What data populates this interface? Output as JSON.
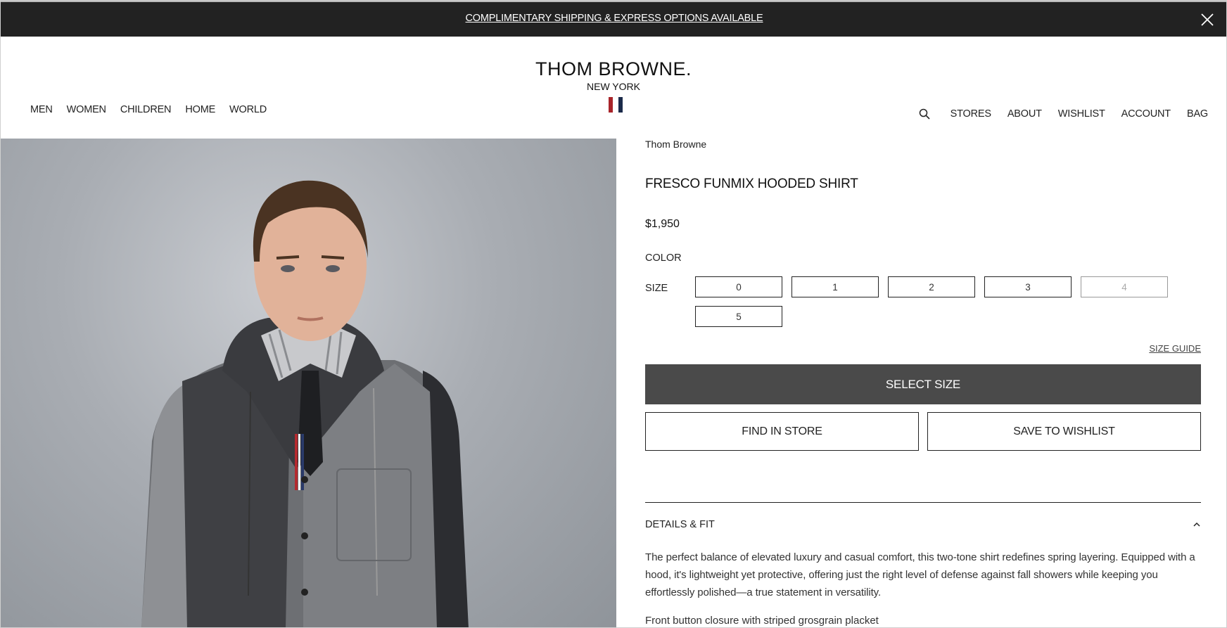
{
  "banner": {
    "text": "COMPLIMENTARY SHIPPING & EXPRESS OPTIONS AVAILABLE"
  },
  "header": {
    "logo_main": "THOM BROWNE.",
    "logo_sub": "NEW YORK",
    "flag_colors": [
      "#a8242a",
      "#ffffff",
      "#1b2a4a"
    ],
    "nav_left": [
      "MEN",
      "WOMEN",
      "CHILDREN",
      "HOME",
      "WORLD"
    ],
    "nav_right": [
      "STORES",
      "ABOUT",
      "WISHLIST",
      "ACCOUNT",
      "BAG"
    ]
  },
  "product": {
    "brand": "Thom Browne",
    "title": "FRESCO FUNMIX HOODED SHIRT",
    "price": "$1,950",
    "color_label": "COLOR",
    "size_label": "SIZE",
    "sizes": [
      {
        "label": "0",
        "available": true
      },
      {
        "label": "1",
        "available": true
      },
      {
        "label": "2",
        "available": true
      },
      {
        "label": "3",
        "available": true
      },
      {
        "label": "4",
        "available": false
      },
      {
        "label": "5",
        "available": true
      }
    ],
    "size_guide": "SIZE GUIDE",
    "select_size": "SELECT SIZE",
    "find_in_store": "FIND IN STORE",
    "save_to_wishlist": "SAVE TO WISHLIST",
    "details_title": "DETAILS & FIT",
    "description": "The perfect balance of elevated luxury and casual comfort, this two-tone shirt redefines spring layering. Equipped with a hood, it's lightweight yet protective, offering just the right level of defense against fall showers while keeping you effortlessly polished—a true statement in versatility.",
    "feature_1": "Front button closure with striped grosgrain placket"
  },
  "colors": {
    "banner_bg": "#222222",
    "primary_button": "#4a4a4a"
  }
}
